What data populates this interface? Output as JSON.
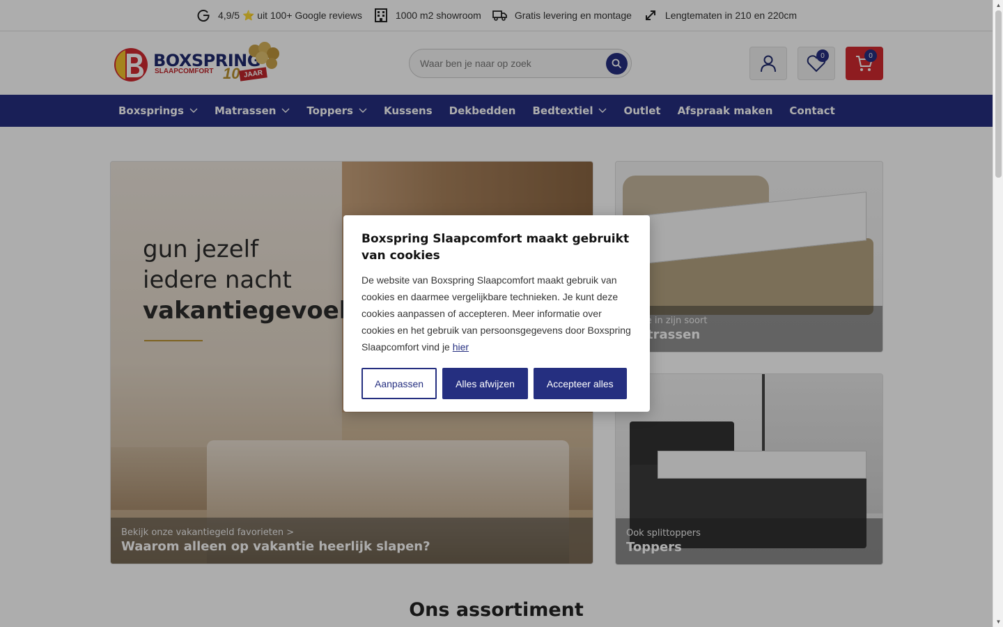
{
  "usp": [
    {
      "icon": "google-icon",
      "text": "4,9/5 ⭐ uit 100+ Google reviews"
    },
    {
      "icon": "store-icon",
      "text": "1000 m2 showroom"
    },
    {
      "icon": "truck-icon",
      "text": "Gratis levering en montage"
    },
    {
      "icon": "resize-arrow-icon",
      "text": "Lengtematen in 210 en 220cm"
    }
  ],
  "logo": {
    "name": "BOXSPRING",
    "sub": "SLAAPCOMFORT",
    "years": "10",
    "jaar": "JAAR"
  },
  "search": {
    "placeholder": "Waar ben je naar op zoek"
  },
  "header": {
    "wishlist_count": "0",
    "cart_count": "0"
  },
  "nav": [
    {
      "label": "Boxsprings",
      "dropdown": true
    },
    {
      "label": "Matrassen",
      "dropdown": true
    },
    {
      "label": "Toppers",
      "dropdown": true
    },
    {
      "label": "Kussens",
      "dropdown": false
    },
    {
      "label": "Dekbedden",
      "dropdown": false
    },
    {
      "label": "Bedtextiel",
      "dropdown": true
    },
    {
      "label": "Outlet",
      "dropdown": false
    },
    {
      "label": "Afspraak maken",
      "dropdown": false
    },
    {
      "label": "Contact",
      "dropdown": false
    }
  ],
  "hero": {
    "slogan_line1": "gun jezelf",
    "slogan_line2": "iedere nacht",
    "slogan_line3": "vakantiegevoel",
    "caption_small": "Bekijk onze vakantiegeld favorieten >",
    "caption_big": "Waarom alleen op vakantie heerlijk slapen?"
  },
  "cards": [
    {
      "small": "Beste in zijn soort",
      "big": "Matrassen"
    },
    {
      "small": "Ook splittoppers",
      "big": "Toppers"
    }
  ],
  "section_title": "Ons assortiment",
  "cookie": {
    "title": "Boxspring Slaapcomfort maakt gebruikt van cookies",
    "body": "De website van Boxspring Slaapcomfort maakt gebruik van cookies en daarmee vergelijkbare technieken. Je kunt deze cookies aanpassen of accepteren. Meer informatie over cookies en het gebruik van persoonsgegevens door Boxspring Slaapcomfort vind je ",
    "link": "hier",
    "btn_customize": "Aanpassen",
    "btn_reject": "Alles afwijzen",
    "btn_accept": "Accepteer alles"
  },
  "colors": {
    "brand_blue": "#252f80",
    "brand_red": "#d12a30",
    "gold": "#b8912e"
  }
}
